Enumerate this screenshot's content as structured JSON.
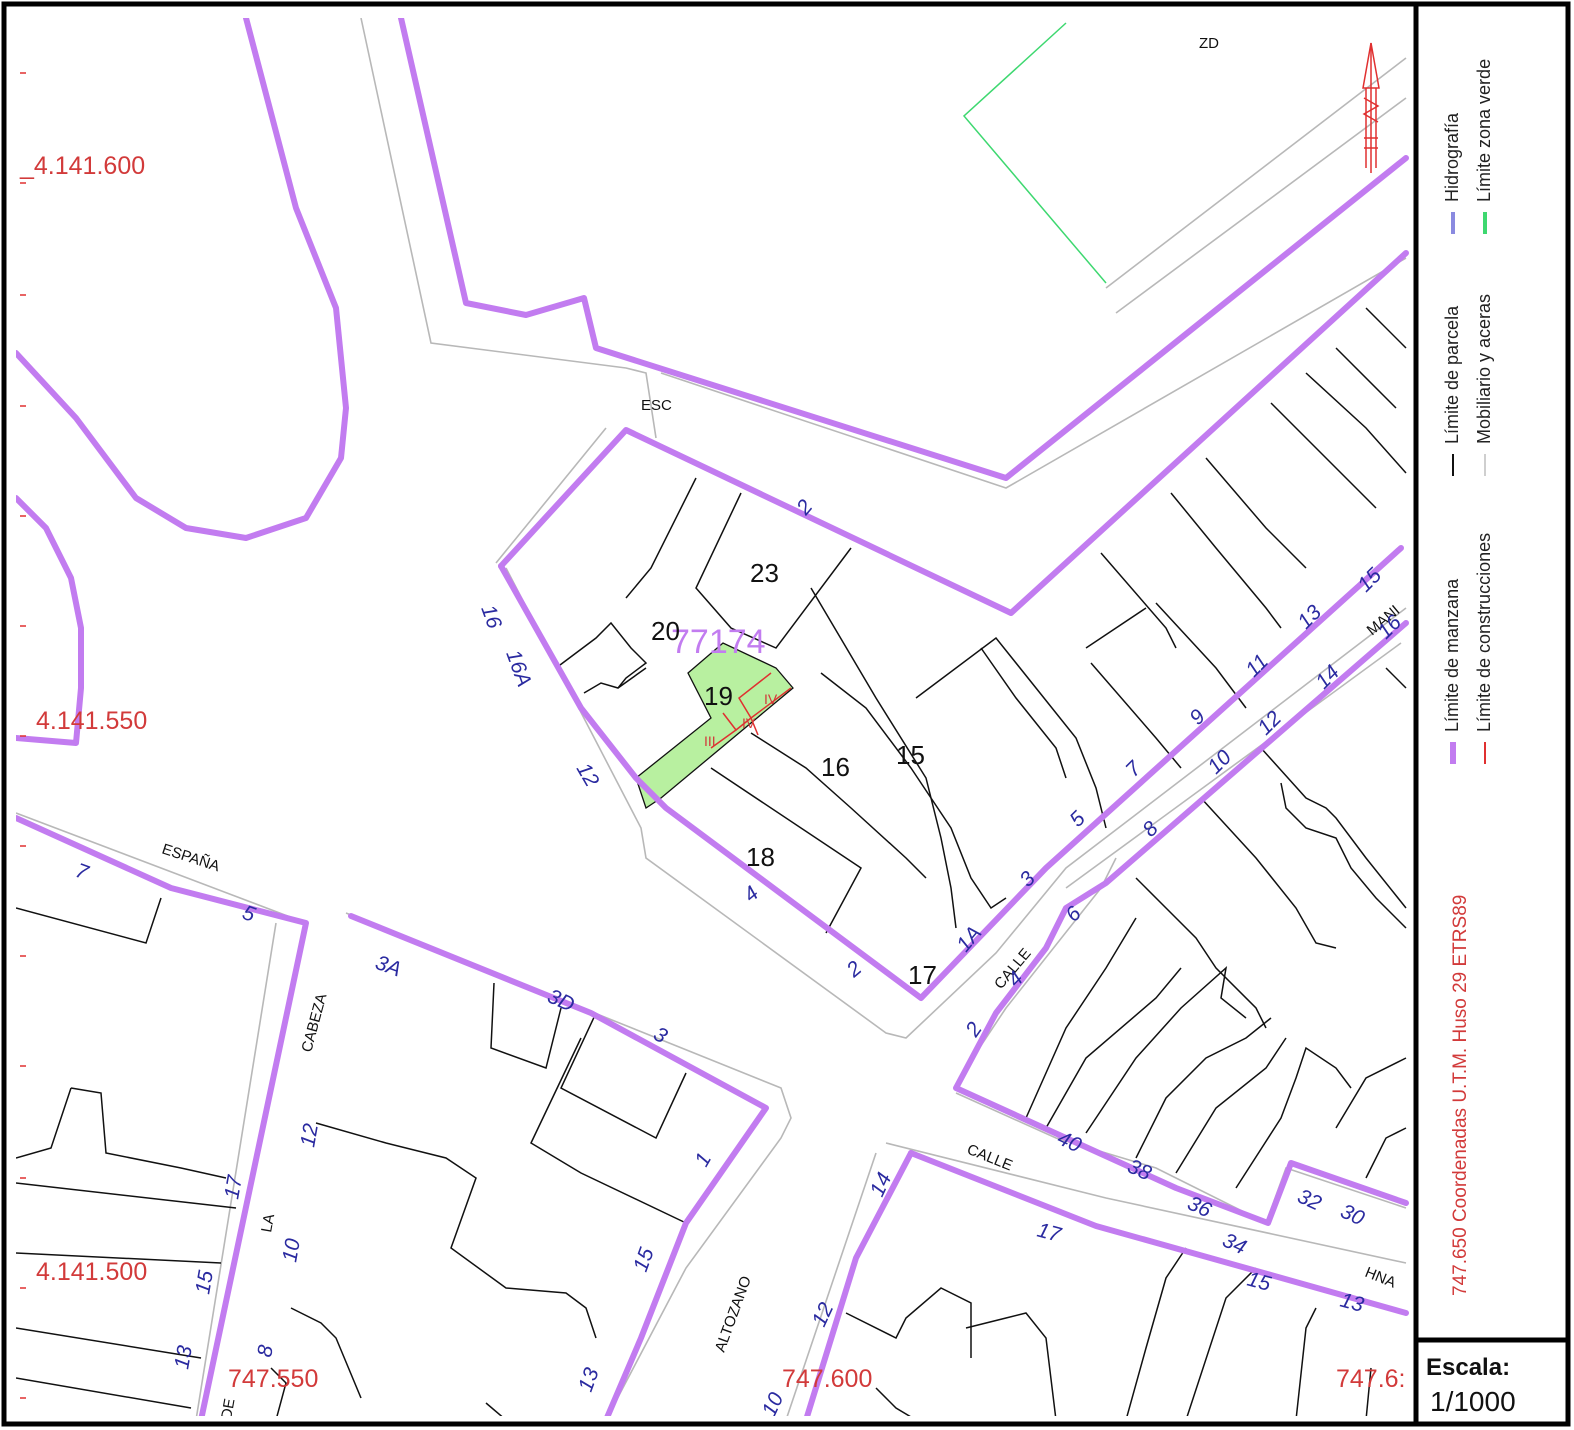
{
  "legend": {
    "items": [
      {
        "label": "Límite de manzana",
        "color": "#c27cf0"
      },
      {
        "label": "Límite de parcela",
        "color": "#111111"
      },
      {
        "label": "Hidrografía",
        "color": "#8a8ae0"
      },
      {
        "label": "Límite de construcciones",
        "color": "#e03030"
      },
      {
        "label": "Mobiliario y aceras",
        "color": "#cfcfcf"
      },
      {
        "label": "Límite zona verde",
        "color": "#3ed870"
      }
    ],
    "coords_note": "747.650 Coordenadas U.T.M. Huso 29 ETRS89"
  },
  "scale": {
    "title": "Escala:",
    "value": "1/1000"
  },
  "grid": {
    "northings": [
      "_4.141.600",
      "4.141.550",
      "4.141.500"
    ],
    "eastings": [
      "747.550",
      "747.600",
      "747.6:"
    ]
  },
  "map": {
    "streets": {
      "espana": "ESPAÑA",
      "cabeza": "CABEZA",
      "la": "LA",
      "de": "DE",
      "altozano": "ALTOZANO",
      "calle_mid": "CALLE",
      "calle_low": "CALLE",
      "hna": "HNA",
      "mani": "MANI",
      "esc": "ESC",
      "zd": "ZD"
    },
    "block_number": "77174",
    "selected_parcel": "19",
    "parcel_numbers": [
      "23",
      "20",
      "16",
      "15",
      "18",
      "17"
    ],
    "floors": [
      "III",
      "IV",
      "IV"
    ],
    "house_numbers": {
      "n2_top": "2",
      "n16": "16",
      "n16a": "16A",
      "n12_left": "12",
      "n4": "4",
      "n2_bottom": "2",
      "n1a": "1A",
      "n3": "3",
      "n5": "5",
      "n7": "7",
      "n9": "9",
      "n11": "11",
      "n13": "13",
      "n15": "15",
      "n16r": "16",
      "n14": "14",
      "n12r": "12",
      "n10r": "10",
      "n8r": "8",
      "n6r": "6",
      "n4r": "4",
      "n2r": "2",
      "n7l": "7",
      "n5l": "5",
      "n3a": "3A",
      "n3d": "3D",
      "n1": "1",
      "n15b": "15",
      "n13b": "13",
      "n12c": "12",
      "n10c": "10",
      "n8c": "8",
      "n17c": "17",
      "n15c": "15",
      "n13c": "13",
      "n40": "40",
      "n38": "38",
      "n36": "36",
      "n34": "34",
      "n32": "32",
      "n30": "30",
      "n14b": "14",
      "n12b": "12",
      "n10b": "10",
      "n17b": "17",
      "n15d": "15",
      "n13d": "13"
    }
  }
}
